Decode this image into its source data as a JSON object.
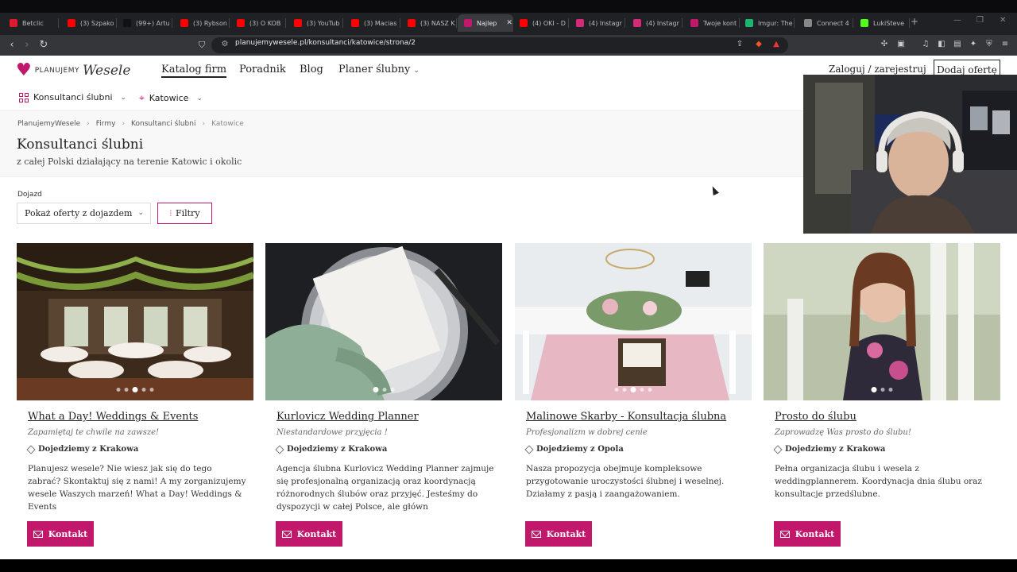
{
  "browser": {
    "tabs": [
      {
        "label": "Betclic",
        "color": "#e0182d",
        "active": false
      },
      {
        "label": "(3) Szpako",
        "color": "#ff0000",
        "active": false
      },
      {
        "label": "(99+) Artu",
        "color": "#111111",
        "active": false
      },
      {
        "label": "(3) Rybson",
        "color": "#ff0000",
        "active": false
      },
      {
        "label": "(3) O KOB",
        "color": "#ff0000",
        "active": false
      },
      {
        "label": "(3) YouTub",
        "color": "#ff0000",
        "active": false
      },
      {
        "label": "(3) Macias",
        "color": "#ff0000",
        "active": false
      },
      {
        "label": "(3) NASZ K",
        "color": "#ff0000",
        "active": false
      },
      {
        "label": "Najlep",
        "color": "#c2186b",
        "active": true
      },
      {
        "label": "(4) OKI - D",
        "color": "#ff0000",
        "active": false
      },
      {
        "label": "(4) Instagr",
        "color": "#d62976",
        "active": false
      },
      {
        "label": "(4) Instagr",
        "color": "#d62976",
        "active": false
      },
      {
        "label": "Twoje kont",
        "color": "#c2186b",
        "active": false
      },
      {
        "label": "Imgur: The",
        "color": "#1bb76e",
        "active": false
      },
      {
        "label": "Connect 4",
        "color": "#888888",
        "active": false
      },
      {
        "label": "LukiSteve",
        "color": "#53fc18",
        "active": false
      }
    ],
    "url": "planujemywesele.pl/konsultanci/katowice/strona/2"
  },
  "site": {
    "logo_line1": "PLANUJEMY",
    "logo_line2": "Wesele",
    "nav": {
      "catalog": "Katalog firm",
      "guide": "Poradnik",
      "blog": "Blog",
      "planner": "Planer ślubny"
    },
    "login": "Zaloguj / zarejestruj",
    "add_offer": "Dodaj ofertę",
    "subnav": {
      "category": "Konsultanci ślubni",
      "city": "Katowice"
    },
    "breadcrumbs": [
      "PlanujemyWesele",
      "Firmy",
      "Konsultanci ślubni",
      "Katowice"
    ],
    "page_title": "Konsultanci ślubni",
    "page_subtitle": "z całej Polski działający na terenie Katowic i okolic",
    "filter": {
      "label": "Dojazd",
      "select_value": "Pokaż oferty z dojazdem",
      "filters_button": "Filtry"
    },
    "cards": [
      {
        "title": "What a Day! Weddings & Events",
        "tagline": "Zapamiętaj te chwile na zawsze!",
        "location": "Dojedziemy z Krakowa",
        "description": "Planujesz wesele? Nie wiesz jak się do tego zabrać? Skontaktuj się z nami! A my zorganizujemy wesele Waszych marzeń! What a Day! Weddings & Events",
        "button": "Kontakt"
      },
      {
        "title": "Kurlovicz Wedding Planner",
        "tagline": "Niestandardowe przyjęcia !",
        "location": "Dojedziemy z Krakowa",
        "description": "Agencja ślubna Kurlovicz Wedding Planner zajmuje się profesjonalną organizacją oraz koordynacją różnorodnych ślubów oraz przyjęć. Jesteśmy do dyspozycji w całej Polsce, ale główn",
        "button": "Kontakt"
      },
      {
        "title": "Malinowe Skarby - Konsultacja ślubna",
        "tagline": "Profesjonalizm w dobrej cenie",
        "location": "Dojedziemy z Opola",
        "description": "Nasza propozycja obejmuje kompleksowe przygotowanie uroczystości ślubnej i weselnej. Działamy z pasją i zaangażowaniem.",
        "button": "Kontakt"
      },
      {
        "title": "Prosto do ślubu",
        "tagline": "Zaprowadzę Was prosto do ślubu!",
        "location": "Dojedziemy z Krakowa",
        "description": "Pełna organizacja ślubu i wesela z weddingplannerem. Koordynacja dnia ślubu oraz konsultacje przedślubne.",
        "button": "Kontakt"
      }
    ]
  },
  "colors": {
    "brand": "#c2186b",
    "chrome_dark": "#202124"
  }
}
